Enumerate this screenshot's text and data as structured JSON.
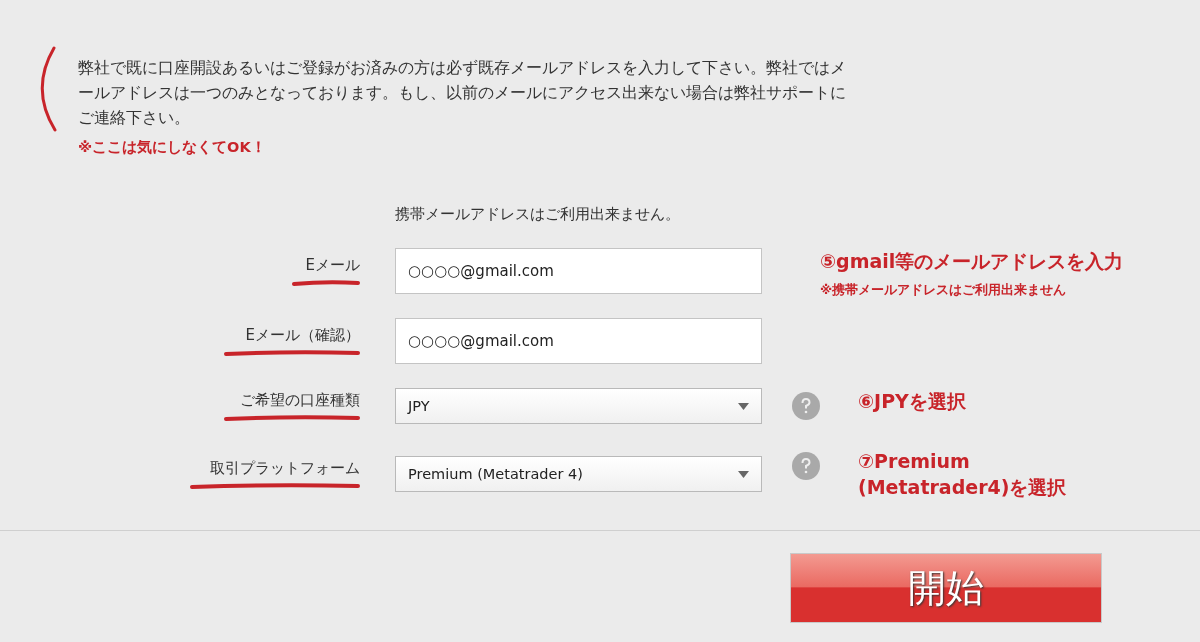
{
  "notice": {
    "text": "弊社で既に口座開設あるいはご登録がお済みの方は必ず既存メールアドレスを入力して下さい。弊社ではメールアドレスは一つのみとなっております。もし、以前のメールにアクセス出来ない場合は弊社サポートにご連絡下さい。",
    "bracketed": true,
    "remark": "※ここは気にしなくてOK！"
  },
  "hint": "携帯メールアドレスはご利用出来ません。",
  "fields": [
    {
      "kind": "input",
      "label": "Eメール",
      "underlined": true,
      "value": "○○○○@gmail.com",
      "help": false,
      "annotation": "⑤gmail等のメールアドレスを入力",
      "annotation_note": "※携帯メールアドレスはご利用出来ません"
    },
    {
      "kind": "input",
      "label": "Eメール（確認）",
      "underlined": true,
      "value": "○○○○@gmail.com",
      "help": false
    },
    {
      "kind": "select",
      "label": "ご希望の口座種類",
      "underlined": true,
      "value": "JPY",
      "help": true,
      "annotation": "⑥JPYを選択"
    },
    {
      "kind": "select",
      "label": "取引プラットフォーム",
      "underlined": true,
      "value": "Premium (Metatrader 4)",
      "help": true,
      "annotation": "⑦Premium\n(Metatrader4)を選択"
    }
  ],
  "submit": "開始"
}
